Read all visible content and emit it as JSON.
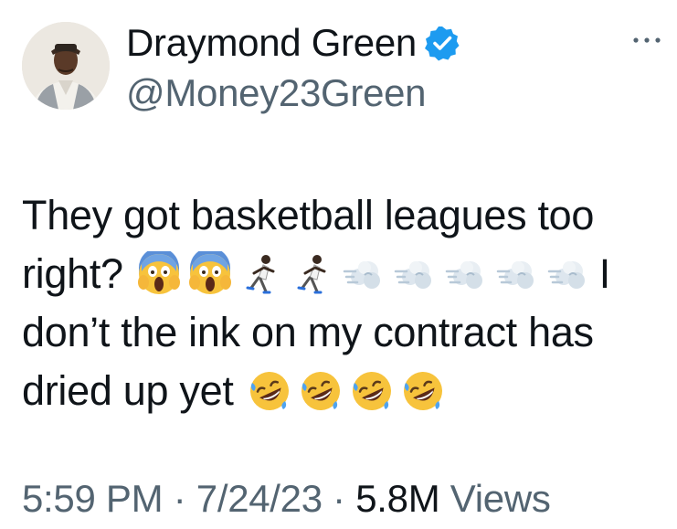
{
  "author": {
    "display_name": "Draymond Green",
    "handle": "@Money23Green",
    "verified": true
  },
  "tweet": {
    "line1": "They got basketball leagues too",
    "line2_text": "right?",
    "line2_after": "I",
    "line3": "don’t the ink on my contract has",
    "line4_text": "dried up yet",
    "emojis": {
      "line2_before": [
        "face-screaming-in-fear",
        "face-screaming-in-fear",
        "person-running",
        "person-running",
        "dashing-away",
        "dashing-away",
        "dashing-away",
        "dashing-away",
        "dashing-away"
      ],
      "line4_after": [
        "rolling-on-the-floor-laughing",
        "rolling-on-the-floor-laughing",
        "rolling-on-the-floor-laughing",
        "rolling-on-the-floor-laughing"
      ]
    }
  },
  "meta": {
    "time": "5:59 PM",
    "sep1": " · ",
    "date": "7/24/23",
    "sep2": " · ",
    "views_count": "5.8M",
    "views_label": " Views"
  },
  "colors": {
    "text_primary": "#0f1419",
    "text_secondary": "#536471",
    "verified_blue": "#1d9bf0"
  },
  "icons": {
    "verified": "verified-badge-icon",
    "more": "more-options-icon"
  }
}
